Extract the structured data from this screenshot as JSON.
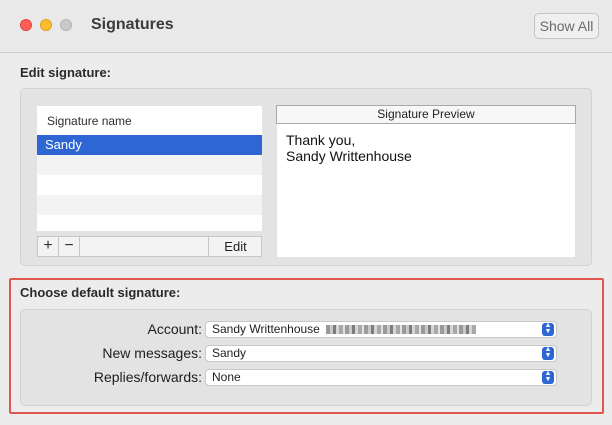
{
  "window": {
    "title": "Signatures",
    "show_all_label": "Show All"
  },
  "edit_section": {
    "label": "Edit signature:",
    "list_header": "Signature name",
    "signatures": [
      "Sandy"
    ],
    "add_label": "+",
    "remove_label": "−",
    "edit_label": "Edit",
    "preview_header": "Signature Preview",
    "preview_lines": [
      "Thank you,",
      "Sandy Writtenhouse"
    ]
  },
  "default_section": {
    "label": "Choose default signature:",
    "fields": [
      {
        "label": "Account:",
        "value": "Sandy Writtenhouse"
      },
      {
        "label": "New messages:",
        "value": "Sandy"
      },
      {
        "label": "Replies/forwards:",
        "value": "None"
      }
    ]
  },
  "colors": {
    "selection": "#2e67d4",
    "highlight_border": "#e0554d"
  },
  "icons": [
    "close-icon",
    "minimize-icon",
    "zoom-icon",
    "popup-chevrons-icon"
  ]
}
